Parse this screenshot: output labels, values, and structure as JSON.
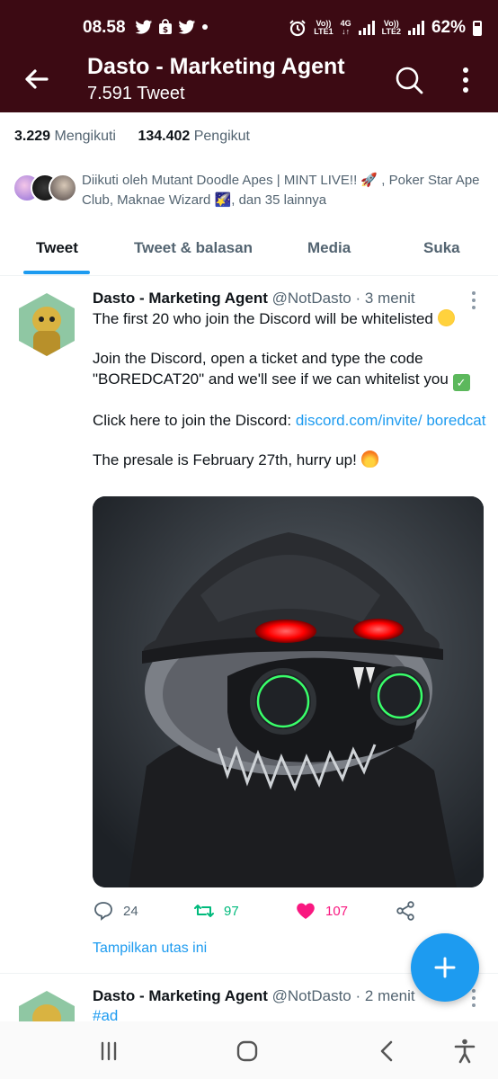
{
  "status": {
    "time": "08.58",
    "net1_top": "Vo))",
    "net1_bottom": "LTE1",
    "net_4g": "4G",
    "net2_top": "Vo))",
    "net2_bottom": "LTE2",
    "battery": "62%"
  },
  "header": {
    "title": "Dasto - Marketing Agent",
    "subtitle": "7.591 Tweet",
    "bg_color": "#3c0a13"
  },
  "profile": {
    "following_count": "3.229",
    "following_label": "Mengikuti",
    "followers_count": "134.402",
    "followers_label": "Pengikut",
    "followed_by_text": "Diikuti oleh Mutant Doodle Apes | MINT LIVE!! 🚀 , Poker Star Ape Club, Maknae Wizard 🌠, dan 35 lainnya"
  },
  "tabs": [
    {
      "label": "Tweet",
      "active": true
    },
    {
      "label": "Tweet & balasan",
      "active": false
    },
    {
      "label": "Media",
      "active": false
    },
    {
      "label": "Suka",
      "active": false
    }
  ],
  "tweet": {
    "name": "Dasto - Marketing Agent",
    "handle": "@NotDasto",
    "time": "3 menit",
    "line1": "The first 20 who join the Discord will be whitelisted",
    "line2": "Join the Discord, open a ticket and type the code \"BOREDCAT20\" and we'll see if we can whitelist you",
    "line3_prefix": "Click here to join the Discord: ",
    "line3_link": "discord.com/invite/ boredcat",
    "line4": "The presale is February 27th, hurry up!",
    "replies": "24",
    "retweets": "97",
    "likes": "107",
    "show_thread": "Tampilkan utas ini"
  },
  "tweet2": {
    "name": "Dasto - Marketing Agent",
    "handle": "@NotDasto",
    "time": "2 menit",
    "hashtag": "#ad"
  },
  "colors": {
    "accent": "#1d9bf0",
    "retweet": "#00ba7c",
    "like": "#f91880"
  },
  "icons": {
    "back": "arrow-left-icon",
    "search": "search-icon",
    "more": "more-vertical-icon",
    "reply": "reply-icon",
    "retweet": "retweet-icon",
    "like": "heart-icon",
    "share": "share-icon",
    "compose": "plus-icon"
  }
}
